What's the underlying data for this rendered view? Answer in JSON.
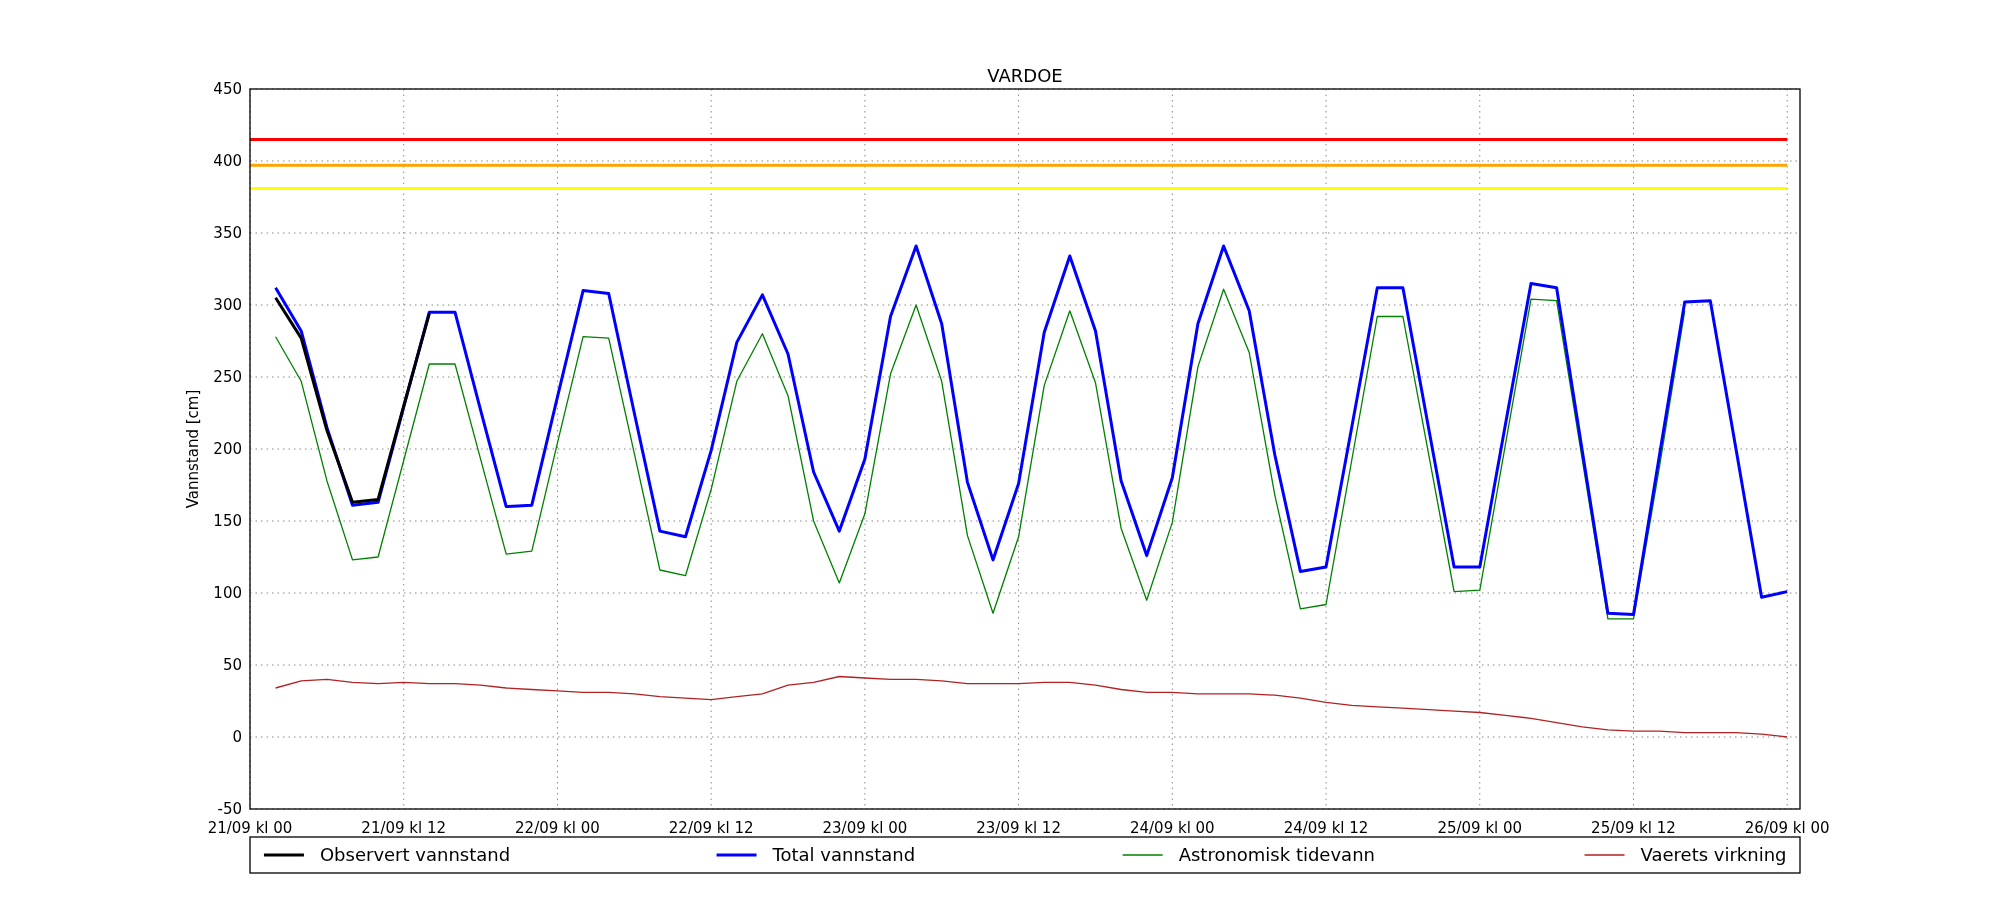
{
  "chart_data": {
    "type": "line",
    "title": "VARDOE",
    "ylabel": "Vannstand [cm]",
    "categories": [
      "21/09 kl 00",
      null,
      null,
      null,
      null,
      null,
      "21/09 kl 12",
      null,
      null,
      null,
      null,
      null,
      "22/09 kl 00",
      null,
      null,
      null,
      null,
      null,
      "22/09 kl 12",
      null,
      null,
      null,
      null,
      null,
      "23/09 kl 00",
      null,
      null,
      null,
      null,
      null,
      "23/09 kl 12",
      null,
      null,
      null,
      null,
      null,
      "24/09 kl 00",
      null,
      null,
      null,
      null,
      null,
      "24/09 kl 12",
      null,
      null,
      null,
      null,
      null,
      "25/09 kl 00",
      null,
      null,
      null,
      null,
      null,
      "25/09 kl 12",
      null,
      null,
      null,
      null,
      null,
      "26/09 kl 00"
    ],
    "ylim": [
      -50,
      450
    ],
    "grid": true,
    "legend": "bottom",
    "yticks": [
      -50,
      0,
      50,
      100,
      150,
      200,
      250,
      300,
      350,
      400,
      450
    ],
    "series": [
      {
        "name": "Observert vannstand",
        "color": "#000000",
        "values": [
          null,
          305,
          277,
          213,
          163,
          165,
          230,
          294,
          null,
          null,
          null,
          null,
          null,
          null,
          null,
          null,
          null,
          null,
          null,
          null,
          null,
          null,
          null,
          null,
          null,
          null,
          null,
          null,
          null,
          null,
          null,
          null,
          null,
          null,
          null,
          null,
          null,
          null,
          null,
          null,
          null,
          null,
          null,
          null,
          null,
          null,
          null,
          null,
          null,
          null,
          null,
          null,
          null,
          null,
          null,
          null,
          null,
          null,
          null,
          null,
          null
        ]
      },
      {
        "name": "Total vannstand",
        "color": "#0000ff",
        "values": [
          null,
          312,
          282,
          215,
          161,
          163,
          229,
          295,
          295,
          227,
          160,
          161,
          236,
          310,
          308,
          225,
          143,
          139,
          199,
          274,
          307,
          266,
          184,
          143,
          193,
          292,
          341,
          287,
          177,
          123,
          176,
          281,
          334,
          282,
          178,
          126,
          180,
          287,
          341,
          296,
          196,
          115,
          118,
          215,
          312,
          312,
          215,
          118,
          118,
          217,
          315,
          312,
          199,
          86,
          85,
          194,
          302,
          303,
          200,
          97,
          101
        ]
      },
      {
        "name": "Astronomisk tidevann",
        "color": "#008000",
        "values": [
          null,
          278,
          247,
          178,
          123,
          125,
          192,
          259,
          259,
          193,
          127,
          129,
          204,
          278,
          277,
          197,
          116,
          112,
          172,
          247,
          280,
          237,
          150,
          107,
          155,
          252,
          300,
          247,
          140,
          86,
          139,
          244,
          296,
          246,
          145,
          95,
          149,
          257,
          311,
          267,
          168,
          89,
          92,
          192,
          292,
          292,
          197,
          101,
          102,
          203,
          304,
          303,
          193,
          82,
          82,
          186,
          296,
          null,
          null,
          null,
          null
        ]
      },
      {
        "name": "Vaerets virkning",
        "color": "#b22222",
        "values": [
          null,
          34,
          39,
          40,
          38,
          37,
          38,
          37,
          37,
          36,
          34,
          33,
          32,
          31,
          31,
          30,
          28,
          27,
          26,
          28,
          30,
          36,
          38,
          42,
          41,
          40,
          40,
          39,
          37,
          37,
          37,
          38,
          38,
          36,
          33,
          31,
          31,
          30,
          30,
          30,
          29,
          27,
          24,
          22,
          21,
          20,
          19,
          18,
          17,
          15,
          13,
          10,
          7,
          5,
          4,
          4,
          3,
          3,
          3,
          2,
          0
        ]
      },
      {
        "color": "#ff0000",
        "values": [
          415,
          415,
          415,
          415,
          415,
          415,
          415,
          415,
          415,
          415,
          415,
          415,
          415,
          415,
          415,
          415,
          415,
          415,
          415,
          415,
          415,
          415,
          415,
          415,
          415,
          415,
          415,
          415,
          415,
          415,
          415,
          415,
          415,
          415,
          415,
          415,
          415,
          415,
          415,
          415,
          415,
          415,
          415,
          415,
          415,
          415,
          415,
          415,
          415,
          415,
          415,
          415,
          415,
          415,
          415,
          415,
          415,
          415,
          415,
          415,
          415
        ]
      },
      {
        "color": "#ffa500",
        "values": [
          397,
          397,
          397,
          397,
          397,
          397,
          397,
          397,
          397,
          397,
          397,
          397,
          397,
          397,
          397,
          397,
          397,
          397,
          397,
          397,
          397,
          397,
          397,
          397,
          397,
          397,
          397,
          397,
          397,
          397,
          397,
          397,
          397,
          397,
          397,
          397,
          397,
          397,
          397,
          397,
          397,
          397,
          397,
          397,
          397,
          397,
          397,
          397,
          397,
          397,
          397,
          397,
          397,
          397,
          397,
          397,
          397,
          397,
          397,
          397,
          397
        ]
      },
      {
        "color": "#ffff00",
        "values": [
          381,
          381,
          381,
          381,
          381,
          381,
          381,
          381,
          381,
          381,
          381,
          381,
          381,
          381,
          381,
          381,
          381,
          381,
          381,
          381,
          381,
          381,
          381,
          381,
          381,
          381,
          381,
          381,
          381,
          381,
          381,
          381,
          381,
          381,
          381,
          381,
          381,
          381,
          381,
          381,
          381,
          381,
          381,
          381,
          381,
          381,
          381,
          381,
          381,
          381,
          381,
          381,
          381,
          381,
          381,
          381,
          381,
          381,
          381,
          381,
          381
        ]
      }
    ]
  }
}
